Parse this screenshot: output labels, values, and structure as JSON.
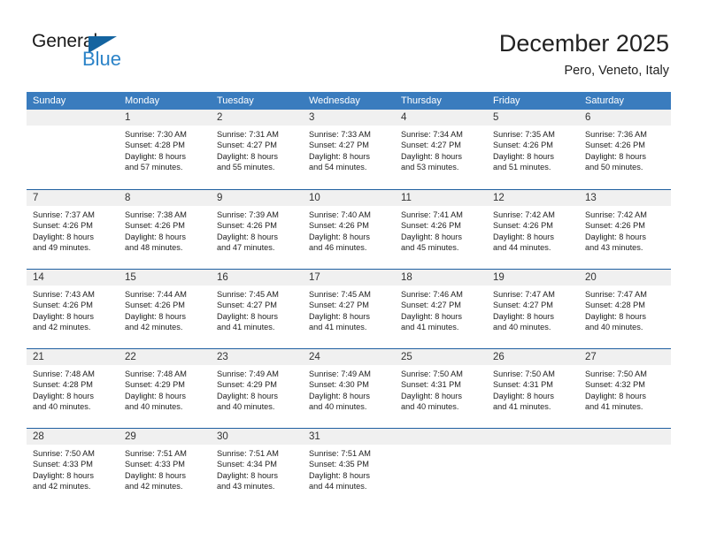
{
  "logo": {
    "word_top": "General",
    "word_bottom": "Blue",
    "triangle_color": "#1464a0",
    "blue_color": "#2b83c8"
  },
  "header": {
    "title": "December 2025",
    "subtitle": "Pero, Veneto, Italy"
  },
  "theme": {
    "header_row_bg": "#3a7cbe",
    "row_divider": "#1f5fa0",
    "day_band_bg": "#f0f0f0",
    "text": "#222222"
  },
  "weekdays": [
    "Sunday",
    "Monday",
    "Tuesday",
    "Wednesday",
    "Thursday",
    "Friday",
    "Saturday"
  ],
  "weeks": [
    [
      {
        "day": "",
        "sunrise": "",
        "sunset": "",
        "daylight_1": "",
        "daylight_2": ""
      },
      {
        "day": "1",
        "sunrise": "Sunrise: 7:30 AM",
        "sunset": "Sunset: 4:28 PM",
        "daylight_1": "Daylight: 8 hours",
        "daylight_2": "and 57 minutes."
      },
      {
        "day": "2",
        "sunrise": "Sunrise: 7:31 AM",
        "sunset": "Sunset: 4:27 PM",
        "daylight_1": "Daylight: 8 hours",
        "daylight_2": "and 55 minutes."
      },
      {
        "day": "3",
        "sunrise": "Sunrise: 7:33 AM",
        "sunset": "Sunset: 4:27 PM",
        "daylight_1": "Daylight: 8 hours",
        "daylight_2": "and 54 minutes."
      },
      {
        "day": "4",
        "sunrise": "Sunrise: 7:34 AM",
        "sunset": "Sunset: 4:27 PM",
        "daylight_1": "Daylight: 8 hours",
        "daylight_2": "and 53 minutes."
      },
      {
        "day": "5",
        "sunrise": "Sunrise: 7:35 AM",
        "sunset": "Sunset: 4:26 PM",
        "daylight_1": "Daylight: 8 hours",
        "daylight_2": "and 51 minutes."
      },
      {
        "day": "6",
        "sunrise": "Sunrise: 7:36 AM",
        "sunset": "Sunset: 4:26 PM",
        "daylight_1": "Daylight: 8 hours",
        "daylight_2": "and 50 minutes."
      }
    ],
    [
      {
        "day": "7",
        "sunrise": "Sunrise: 7:37 AM",
        "sunset": "Sunset: 4:26 PM",
        "daylight_1": "Daylight: 8 hours",
        "daylight_2": "and 49 minutes."
      },
      {
        "day": "8",
        "sunrise": "Sunrise: 7:38 AM",
        "sunset": "Sunset: 4:26 PM",
        "daylight_1": "Daylight: 8 hours",
        "daylight_2": "and 48 minutes."
      },
      {
        "day": "9",
        "sunrise": "Sunrise: 7:39 AM",
        "sunset": "Sunset: 4:26 PM",
        "daylight_1": "Daylight: 8 hours",
        "daylight_2": "and 47 minutes."
      },
      {
        "day": "10",
        "sunrise": "Sunrise: 7:40 AM",
        "sunset": "Sunset: 4:26 PM",
        "daylight_1": "Daylight: 8 hours",
        "daylight_2": "and 46 minutes."
      },
      {
        "day": "11",
        "sunrise": "Sunrise: 7:41 AM",
        "sunset": "Sunset: 4:26 PM",
        "daylight_1": "Daylight: 8 hours",
        "daylight_2": "and 45 minutes."
      },
      {
        "day": "12",
        "sunrise": "Sunrise: 7:42 AM",
        "sunset": "Sunset: 4:26 PM",
        "daylight_1": "Daylight: 8 hours",
        "daylight_2": "and 44 minutes."
      },
      {
        "day": "13",
        "sunrise": "Sunrise: 7:42 AM",
        "sunset": "Sunset: 4:26 PM",
        "daylight_1": "Daylight: 8 hours",
        "daylight_2": "and 43 minutes."
      }
    ],
    [
      {
        "day": "14",
        "sunrise": "Sunrise: 7:43 AM",
        "sunset": "Sunset: 4:26 PM",
        "daylight_1": "Daylight: 8 hours",
        "daylight_2": "and 42 minutes."
      },
      {
        "day": "15",
        "sunrise": "Sunrise: 7:44 AM",
        "sunset": "Sunset: 4:26 PM",
        "daylight_1": "Daylight: 8 hours",
        "daylight_2": "and 42 minutes."
      },
      {
        "day": "16",
        "sunrise": "Sunrise: 7:45 AM",
        "sunset": "Sunset: 4:27 PM",
        "daylight_1": "Daylight: 8 hours",
        "daylight_2": "and 41 minutes."
      },
      {
        "day": "17",
        "sunrise": "Sunrise: 7:45 AM",
        "sunset": "Sunset: 4:27 PM",
        "daylight_1": "Daylight: 8 hours",
        "daylight_2": "and 41 minutes."
      },
      {
        "day": "18",
        "sunrise": "Sunrise: 7:46 AM",
        "sunset": "Sunset: 4:27 PM",
        "daylight_1": "Daylight: 8 hours",
        "daylight_2": "and 41 minutes."
      },
      {
        "day": "19",
        "sunrise": "Sunrise: 7:47 AM",
        "sunset": "Sunset: 4:27 PM",
        "daylight_1": "Daylight: 8 hours",
        "daylight_2": "and 40 minutes."
      },
      {
        "day": "20",
        "sunrise": "Sunrise: 7:47 AM",
        "sunset": "Sunset: 4:28 PM",
        "daylight_1": "Daylight: 8 hours",
        "daylight_2": "and 40 minutes."
      }
    ],
    [
      {
        "day": "21",
        "sunrise": "Sunrise: 7:48 AM",
        "sunset": "Sunset: 4:28 PM",
        "daylight_1": "Daylight: 8 hours",
        "daylight_2": "and 40 minutes."
      },
      {
        "day": "22",
        "sunrise": "Sunrise: 7:48 AM",
        "sunset": "Sunset: 4:29 PM",
        "daylight_1": "Daylight: 8 hours",
        "daylight_2": "and 40 minutes."
      },
      {
        "day": "23",
        "sunrise": "Sunrise: 7:49 AM",
        "sunset": "Sunset: 4:29 PM",
        "daylight_1": "Daylight: 8 hours",
        "daylight_2": "and 40 minutes."
      },
      {
        "day": "24",
        "sunrise": "Sunrise: 7:49 AM",
        "sunset": "Sunset: 4:30 PM",
        "daylight_1": "Daylight: 8 hours",
        "daylight_2": "and 40 minutes."
      },
      {
        "day": "25",
        "sunrise": "Sunrise: 7:50 AM",
        "sunset": "Sunset: 4:31 PM",
        "daylight_1": "Daylight: 8 hours",
        "daylight_2": "and 40 minutes."
      },
      {
        "day": "26",
        "sunrise": "Sunrise: 7:50 AM",
        "sunset": "Sunset: 4:31 PM",
        "daylight_1": "Daylight: 8 hours",
        "daylight_2": "and 41 minutes."
      },
      {
        "day": "27",
        "sunrise": "Sunrise: 7:50 AM",
        "sunset": "Sunset: 4:32 PM",
        "daylight_1": "Daylight: 8 hours",
        "daylight_2": "and 41 minutes."
      }
    ],
    [
      {
        "day": "28",
        "sunrise": "Sunrise: 7:50 AM",
        "sunset": "Sunset: 4:33 PM",
        "daylight_1": "Daylight: 8 hours",
        "daylight_2": "and 42 minutes."
      },
      {
        "day": "29",
        "sunrise": "Sunrise: 7:51 AM",
        "sunset": "Sunset: 4:33 PM",
        "daylight_1": "Daylight: 8 hours",
        "daylight_2": "and 42 minutes."
      },
      {
        "day": "30",
        "sunrise": "Sunrise: 7:51 AM",
        "sunset": "Sunset: 4:34 PM",
        "daylight_1": "Daylight: 8 hours",
        "daylight_2": "and 43 minutes."
      },
      {
        "day": "31",
        "sunrise": "Sunrise: 7:51 AM",
        "sunset": "Sunset: 4:35 PM",
        "daylight_1": "Daylight: 8 hours",
        "daylight_2": "and 44 minutes."
      },
      {
        "day": "",
        "sunrise": "",
        "sunset": "",
        "daylight_1": "",
        "daylight_2": ""
      },
      {
        "day": "",
        "sunrise": "",
        "sunset": "",
        "daylight_1": "",
        "daylight_2": ""
      },
      {
        "day": "",
        "sunrise": "",
        "sunset": "",
        "daylight_1": "",
        "daylight_2": ""
      }
    ]
  ]
}
